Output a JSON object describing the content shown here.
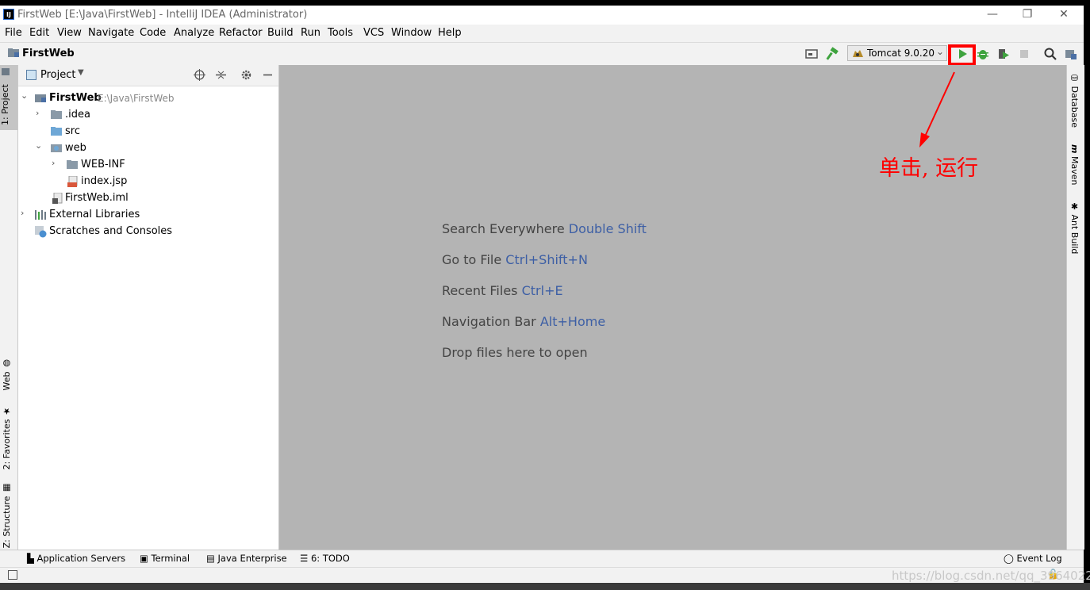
{
  "window": {
    "title": "FirstWeb [E:\\Java\\FirstWeb] - IntelliJ IDEA (Administrator)",
    "app_icon_text": "IJ",
    "minimize": "—",
    "restore": "❐",
    "close": "✕"
  },
  "menu": [
    "File",
    "Edit",
    "View",
    "Navigate",
    "Code",
    "Analyze",
    "Refactor",
    "Build",
    "Run",
    "Tools",
    "VCS",
    "Window",
    "Help"
  ],
  "toolbar": {
    "project_name": "FirstWeb",
    "run_config": "Tomcat 9.0.20",
    "run_config_arrow": "⌄"
  },
  "left_tabs": [
    "1: Project",
    "Web",
    "2: Favorites",
    "Z: Structure"
  ],
  "project_pane": {
    "header": "Project",
    "tree": [
      {
        "label": "FirstWeb",
        "path": "E:\\Java\\FirstWeb"
      },
      {
        "label": ".idea"
      },
      {
        "label": "src"
      },
      {
        "label": "web"
      },
      {
        "label": "WEB-INF"
      },
      {
        "label": "index.jsp"
      },
      {
        "label": "FirstWeb.iml"
      },
      {
        "label": "External Libraries"
      },
      {
        "label": "Scratches and Consoles"
      }
    ]
  },
  "editor": {
    "hints": [
      {
        "text": "Search Everywhere",
        "key": "Double Shift"
      },
      {
        "text": "Go to File",
        "key": "Ctrl+Shift+N"
      },
      {
        "text": "Recent Files",
        "key": "Ctrl+E"
      },
      {
        "text": "Navigation Bar",
        "key": "Alt+Home"
      },
      {
        "text": "Drop files here to open",
        "key": ""
      }
    ]
  },
  "right_tabs": [
    "Database",
    "Maven",
    "Ant Build"
  ],
  "bottom_tools": [
    "Application Servers",
    "Terminal",
    "Java Enterprise",
    "6: TODO"
  ],
  "event_log": "Event Log",
  "annotation": "单击, 运行",
  "watermark": "https://blog.csdn.net/qq_39640226",
  "colors": {
    "highlight": "#ff0000",
    "run_green": "#3ea33e",
    "key_blue": "#3d5fa5"
  }
}
